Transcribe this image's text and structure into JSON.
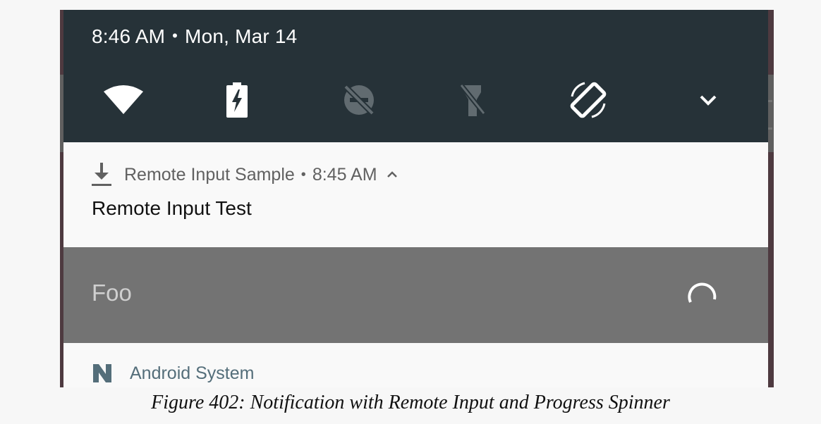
{
  "status_header": {
    "time": "8:46 AM",
    "separator": "•",
    "date": "Mon, Mar 14"
  },
  "quick_settings": {
    "tiles": [
      {
        "icon": "wifi-icon",
        "state": "on"
      },
      {
        "icon": "battery-saver-icon",
        "state": "on"
      },
      {
        "icon": "do-not-disturb-off-icon",
        "state": "off"
      },
      {
        "icon": "flashlight-off-icon",
        "state": "off"
      },
      {
        "icon": "auto-rotate-icon",
        "state": "on"
      },
      {
        "icon": "expand-chevron-icon",
        "state": "collapsed"
      }
    ]
  },
  "notification": {
    "icon": "download-icon",
    "app_name": "Remote Input Sample",
    "separator": "•",
    "time": "8:45 AM",
    "expand_icon": "chevron-up-icon",
    "title": "Remote Input Test"
  },
  "remote_input": {
    "text": "Foo",
    "spinner_icon": "progress-spinner-icon"
  },
  "notification2": {
    "icon": "android-n-icon",
    "app_name": "Android System"
  },
  "caption": "Figure 402: Notification with Remote Input and Progress Spinner",
  "colors": {
    "header_bg": "#263238",
    "notification_bg": "#f9f9f9",
    "remote_input_bg": "#737373",
    "android_system_text": "#546e7a"
  }
}
